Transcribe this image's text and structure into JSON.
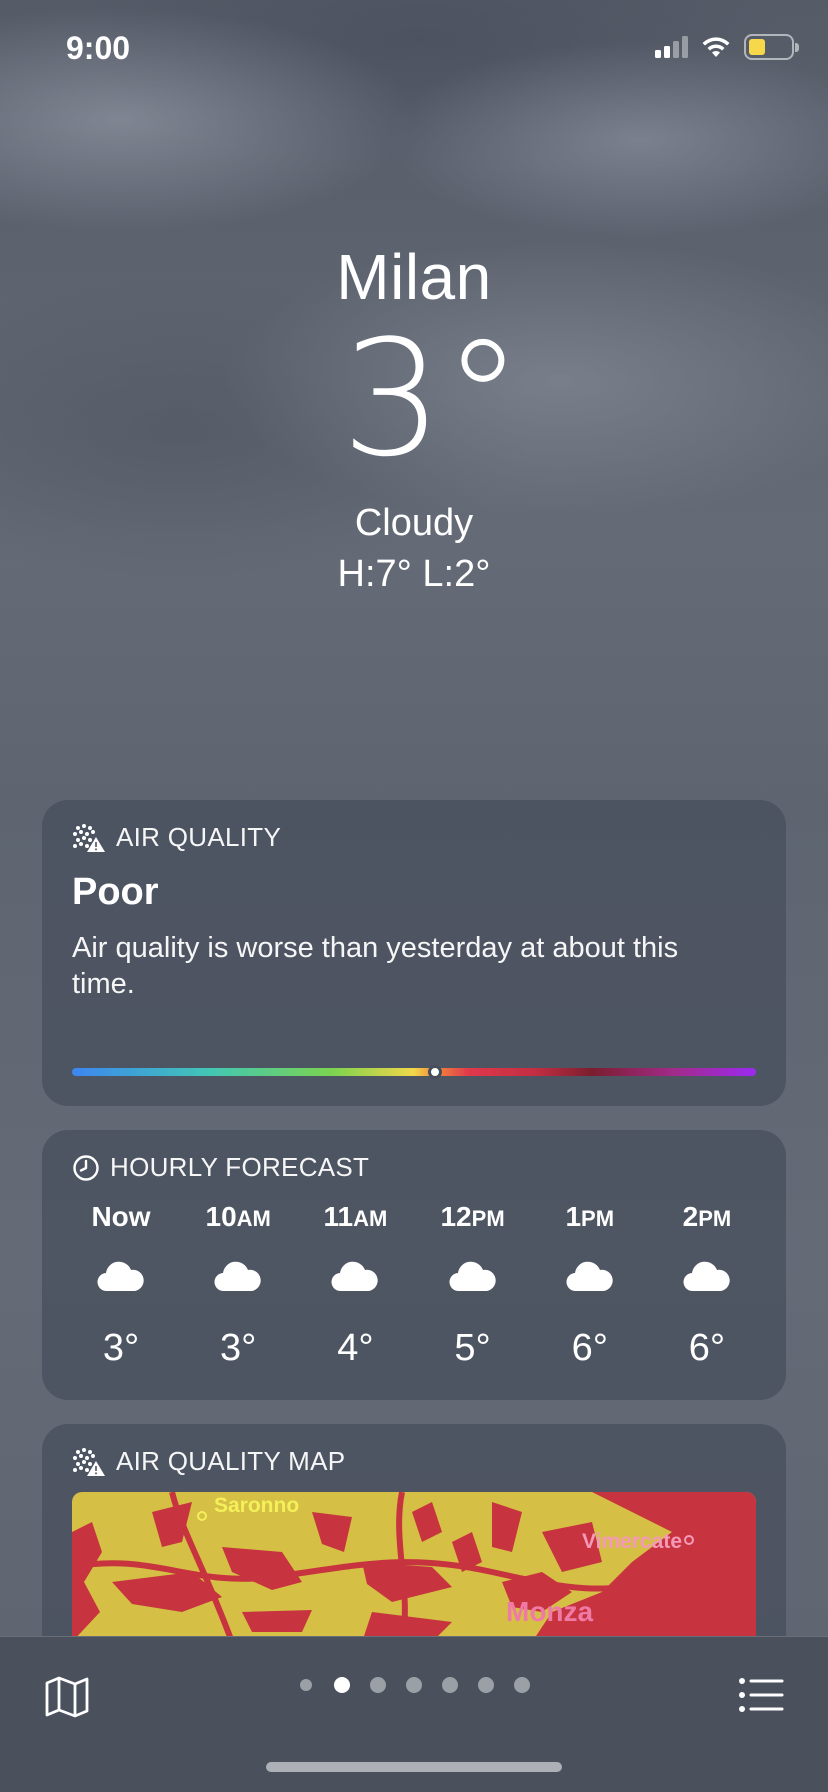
{
  "status_bar": {
    "time": "9:00",
    "battery_level": 0.3,
    "battery_color": "#f7d84a"
  },
  "location": {
    "city": "Milan",
    "temperature": "3°",
    "condition": "Cloudy",
    "high_low": "H:7°  L:2°"
  },
  "air_quality": {
    "title": "AIR QUALITY",
    "icon": "air-quality-icon",
    "level": "Poor",
    "description": "Air quality is worse than yesterday at about this time.",
    "scale_position": 0.53
  },
  "hourly_forecast": {
    "title": "HOURLY FORECAST",
    "icon": "clock-icon",
    "hours": [
      {
        "time": "Now",
        "suffix": "",
        "icon": "cloud-icon",
        "temp": "3°"
      },
      {
        "time": "10",
        "suffix": "AM",
        "icon": "cloud-icon",
        "temp": "3°"
      },
      {
        "time": "11",
        "suffix": "AM",
        "icon": "cloud-icon",
        "temp": "4°"
      },
      {
        "time": "12",
        "suffix": "PM",
        "icon": "cloud-icon",
        "temp": "5°"
      },
      {
        "time": "1",
        "suffix": "PM",
        "icon": "cloud-icon",
        "temp": "6°"
      },
      {
        "time": "2",
        "suffix": "PM",
        "icon": "cloud-icon",
        "temp": "6°"
      }
    ]
  },
  "air_quality_map": {
    "title": "AIR QUALITY MAP",
    "icon": "air-quality-icon",
    "places": [
      {
        "name": "Saronno",
        "color": "#f3f05a"
      },
      {
        "name": "Vimercate",
        "color": "#f49ab8"
      },
      {
        "name": "Monza",
        "color": "#f07aa6"
      }
    ],
    "colors": {
      "moderate": "#d6bf45",
      "poor": "#c7343f"
    }
  },
  "bottom_bar": {
    "map_icon": "map-icon",
    "list_icon": "list-icon",
    "pages": 7,
    "active_page": 1
  }
}
